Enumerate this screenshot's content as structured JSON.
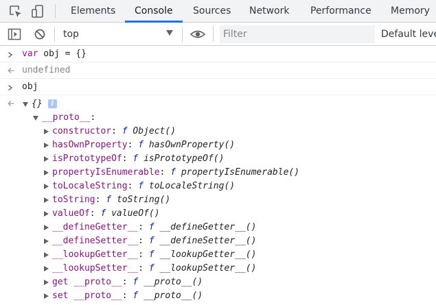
{
  "tabs": [
    {
      "label": "Elements"
    },
    {
      "label": "Console"
    },
    {
      "label": "Sources"
    },
    {
      "label": "Network"
    },
    {
      "label": "Performance"
    },
    {
      "label": "Memory"
    }
  ],
  "toolbar": {
    "context": "top",
    "filter_placeholder": "Filter",
    "levels": "Default levels"
  },
  "console": {
    "input1": {
      "keyword": "var",
      "rest": " obj = {}"
    },
    "result1": "undefined",
    "input2": "obj",
    "object_preview": "{}",
    "info_badge": "i",
    "proto_key": "__proto__",
    "colon": ":",
    "f": "f",
    "proto_members": [
      {
        "name": "constructor",
        "signature": "Object()"
      },
      {
        "name": "hasOwnProperty",
        "signature": "hasOwnProperty()"
      },
      {
        "name": "isPrototypeOf",
        "signature": "isPrototypeOf()"
      },
      {
        "name": "propertyIsEnumerable",
        "signature": "propertyIsEnumerable()"
      },
      {
        "name": "toLocaleString",
        "signature": "toLocaleString()"
      },
      {
        "name": "toString",
        "signature": "toString()"
      },
      {
        "name": "valueOf",
        "signature": "valueOf()"
      },
      {
        "name": "__defineGetter__",
        "signature": "__defineGetter__()"
      },
      {
        "name": "__defineSetter__",
        "signature": "__defineSetter__()"
      },
      {
        "name": "__lookupGetter__",
        "signature": "__lookupGetter__()"
      },
      {
        "name": "__lookupSetter__",
        "signature": "__lookupSetter__()"
      },
      {
        "name": "get __proto__",
        "signature": "__proto__()"
      },
      {
        "name": "set __proto__",
        "signature": "__proto__()"
      }
    ]
  },
  "colors": {
    "accent": "#1a73e8",
    "keyword": "#aa0d91",
    "property": "#881280",
    "function_f": "#0d22aa"
  },
  "icons": {
    "inspect": "inspect-element-icon",
    "device": "device-toolbar-icon",
    "sidebar": "console-sidebar-icon",
    "clear": "clear-console-icon",
    "eye": "live-expression-eye-icon"
  }
}
